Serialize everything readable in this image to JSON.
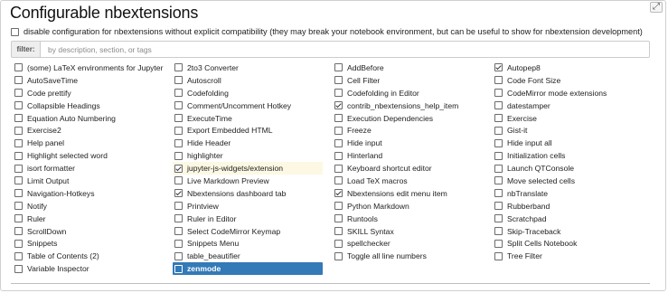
{
  "title": "Configurable nbextensions",
  "disable_option": {
    "label": "disable configuration for nbextensions without explicit compatibility (they may break your notebook environment, but can be useful to show for nbextension development)",
    "checked": false
  },
  "filter": {
    "label": "filter:",
    "placeholder": "by description, section, or tags",
    "value": ""
  },
  "columns": [
    [
      {
        "label": "(some) LaTeX environments for Jupyter",
        "checked": false
      },
      {
        "label": "AutoSaveTime",
        "checked": false
      },
      {
        "label": "Code prettify",
        "checked": false
      },
      {
        "label": "Collapsible Headings",
        "checked": false
      },
      {
        "label": "Equation Auto Numbering",
        "checked": false
      },
      {
        "label": "Exercise2",
        "checked": false
      },
      {
        "label": "Help panel",
        "checked": false
      },
      {
        "label": "Highlight selected word",
        "checked": false
      },
      {
        "label": "isort formatter",
        "checked": false
      },
      {
        "label": "Limit Output",
        "checked": false
      },
      {
        "label": "Navigation-Hotkeys",
        "checked": false
      },
      {
        "label": "Notify",
        "checked": false
      },
      {
        "label": "Ruler",
        "checked": false
      },
      {
        "label": "ScrollDown",
        "checked": false
      },
      {
        "label": "Snippets",
        "checked": false
      },
      {
        "label": "Table of Contents (2)",
        "checked": false
      },
      {
        "label": "Variable Inspector",
        "checked": false
      }
    ],
    [
      {
        "label": "2to3 Converter",
        "checked": false
      },
      {
        "label": "Autoscroll",
        "checked": false
      },
      {
        "label": "Codefolding",
        "checked": false
      },
      {
        "label": "Comment/Uncomment Hotkey",
        "checked": false
      },
      {
        "label": "ExecuteTime",
        "checked": false
      },
      {
        "label": "Export Embedded HTML",
        "checked": false
      },
      {
        "label": "Hide Header",
        "checked": false
      },
      {
        "label": "highlighter",
        "checked": false
      },
      {
        "label": "jupyter-js-widgets/extension",
        "checked": true,
        "highlighted": true
      },
      {
        "label": "Live Markdown Preview",
        "checked": false
      },
      {
        "label": "Nbextensions dashboard tab",
        "checked": true
      },
      {
        "label": "Printview",
        "checked": false
      },
      {
        "label": "Ruler in Editor",
        "checked": false
      },
      {
        "label": "Select CodeMirror Keymap",
        "checked": false
      },
      {
        "label": "Snippets Menu",
        "checked": false
      },
      {
        "label": "table_beautifier",
        "checked": false
      },
      {
        "label": "zenmode",
        "checked": false,
        "selected": true
      }
    ],
    [
      {
        "label": "AddBefore",
        "checked": false
      },
      {
        "label": "Cell Filter",
        "checked": false
      },
      {
        "label": "Codefolding in Editor",
        "checked": false
      },
      {
        "label": "contrib_nbextensions_help_item",
        "checked": true
      },
      {
        "label": "Execution Dependencies",
        "checked": false
      },
      {
        "label": "Freeze",
        "checked": false
      },
      {
        "label": "Hide input",
        "checked": false
      },
      {
        "label": "Hinterland",
        "checked": false
      },
      {
        "label": "Keyboard shortcut editor",
        "checked": false
      },
      {
        "label": "Load TeX macros",
        "checked": false
      },
      {
        "label": "Nbextensions edit menu item",
        "checked": true
      },
      {
        "label": "Python Markdown",
        "checked": false
      },
      {
        "label": "Runtools",
        "checked": false
      },
      {
        "label": "SKILL Syntax",
        "checked": false
      },
      {
        "label": "spellchecker",
        "checked": false
      },
      {
        "label": "Toggle all line numbers",
        "checked": false
      }
    ],
    [
      {
        "label": "Autopep8",
        "checked": true
      },
      {
        "label": "Code Font Size",
        "checked": false
      },
      {
        "label": "CodeMirror mode extensions",
        "checked": false
      },
      {
        "label": "datestamper",
        "checked": false
      },
      {
        "label": "Exercise",
        "checked": false
      },
      {
        "label": "Gist-it",
        "checked": false
      },
      {
        "label": "Hide input all",
        "checked": false
      },
      {
        "label": "Initialization cells",
        "checked": false
      },
      {
        "label": "Launch QTConsole",
        "checked": false
      },
      {
        "label": "Move selected cells",
        "checked": false
      },
      {
        "label": "nbTranslate",
        "checked": false
      },
      {
        "label": "Rubberband",
        "checked": false
      },
      {
        "label": "Scratchpad",
        "checked": false
      },
      {
        "label": "Skip-Traceback",
        "checked": false
      },
      {
        "label": "Split Cells Notebook",
        "checked": false
      },
      {
        "label": "Tree Filter",
        "checked": false
      }
    ]
  ],
  "icons": {
    "corner": "resize-icon"
  },
  "colors": {
    "selected_bg": "#337ab7",
    "highlight_bg": "#fcf8e3"
  }
}
